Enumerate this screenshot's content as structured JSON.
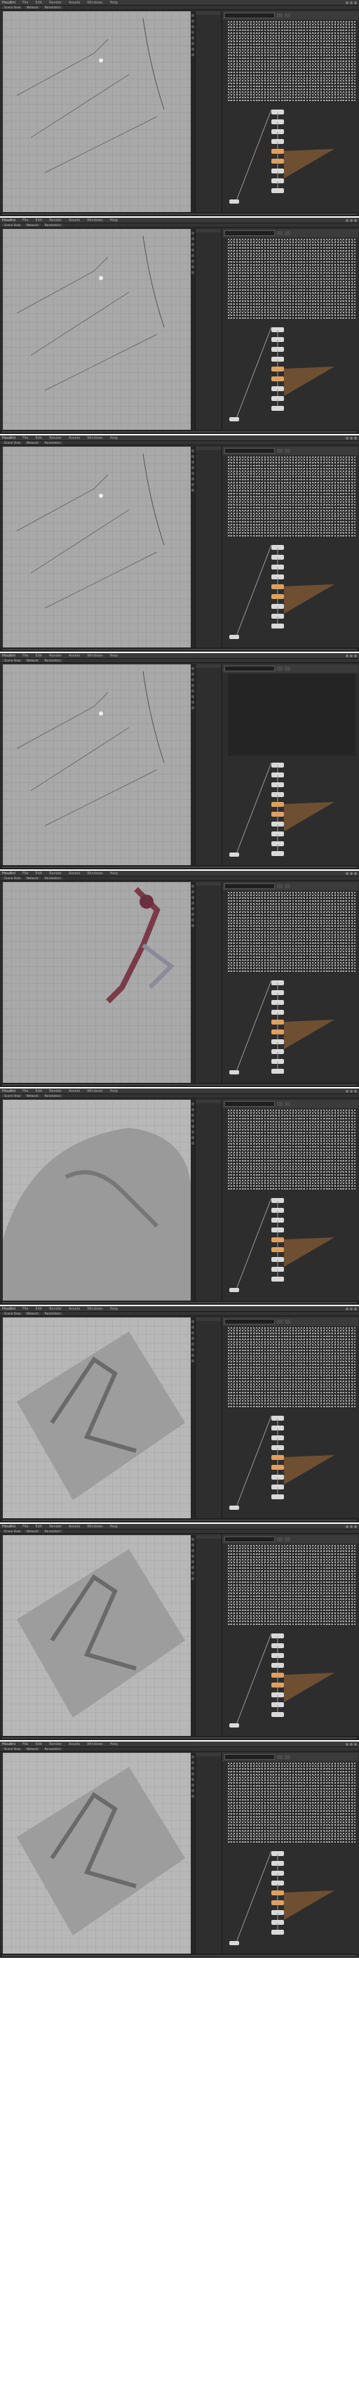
{
  "app": {
    "title_prefix": "Houdini",
    "menu": [
      "File",
      "Edit",
      "Render",
      "Assets",
      "Windows",
      "Help"
    ]
  },
  "tabs": [
    "Scene View",
    "Network",
    "Parameters"
  ],
  "frames": [
    {
      "viewport": "lines",
      "network_nodes": 9
    },
    {
      "viewport": "lines",
      "network_nodes": 9
    },
    {
      "viewport": "lines",
      "network_nodes": 9
    },
    {
      "viewport": "lines",
      "network_nodes": 10,
      "noise_dim": true
    },
    {
      "viewport": "figure",
      "network_nodes": 10
    },
    {
      "viewport": "terrain",
      "network_nodes": 9
    },
    {
      "viewport": "terrain-tilted",
      "network_nodes": 9
    },
    {
      "viewport": "terrain-tilted",
      "network_nodes": 9
    },
    {
      "viewport": "terrain-tilted",
      "network_nodes": 9
    }
  ],
  "colors": {
    "bg": "#2b2b2b",
    "viewport": "#a9a9a9",
    "node": "#d9d9d9",
    "node_active": "#e0a060",
    "wire": "#9a9a9a",
    "orange_fan": "#c07a3a"
  }
}
